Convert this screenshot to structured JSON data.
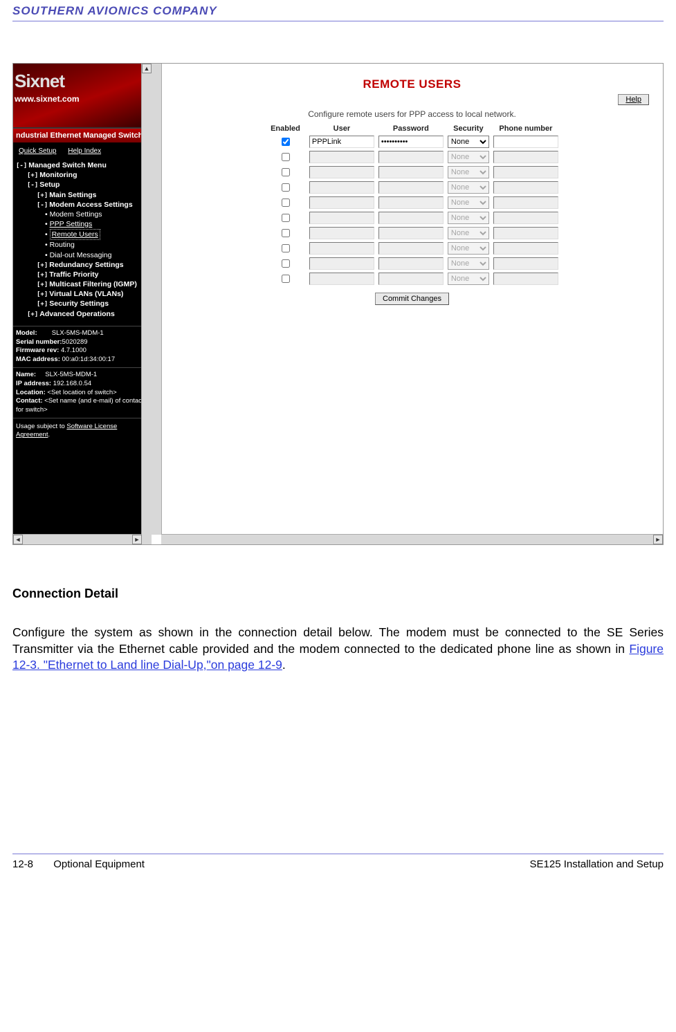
{
  "doc": {
    "header": "SOUTHERN AVIONICS COMPANY",
    "section_heading": "Connection Detail",
    "body_pre": "Configure the system as shown in the connection detail below.  The modem must be connected to the SE Series Transmitter via the Ethernet cable provided and the modem connected to the dedicated phone line as shown in ",
    "body_link": "Figure 12-3. \"Ethernet to Land line Dial-Up,\"on page 12-9",
    "body_post": ".",
    "footer_left_page": "12-8",
    "footer_left_label": "Optional Equipment",
    "footer_right": "SE125 Installation and Setup"
  },
  "app": {
    "logo_name": "Sixnet",
    "logo_url": "www.sixnet.com",
    "switch_title": "ndustrial Ethernet Managed Switch",
    "quick_setup": "Quick Setup",
    "help_index": "Help Index",
    "tree": {
      "root": "Managed Switch Menu",
      "monitoring": "Monitoring",
      "setup": "Setup",
      "main_settings": "Main Settings",
      "modem_access": "Modem Access Settings",
      "modem_settings": "Modem Settings",
      "ppp_settings": "PPP Settings",
      "remote_users": "Remote Users",
      "routing": "Routing",
      "dialout": "Dial-out Messaging",
      "redundancy": "Redundancy Settings",
      "traffic": "Traffic Priority",
      "multicast": "Multicast Filtering (IGMP)",
      "vlans": "Virtual LANs (VLANs)",
      "security": "Security Settings",
      "advanced": "Advanced Operations"
    },
    "device": {
      "model_l": "Model:",
      "model_v": "SLX-5MS-MDM-1",
      "serial_l": "Serial number:",
      "serial_v": "5020289",
      "fw_l": "Firmware rev:",
      "fw_v": "4.7.1000",
      "mac_l": "MAC address:",
      "mac_v": "00:a0:1d:34:00:17",
      "name_l": "Name:",
      "name_v": "SLX-5MS-MDM-1",
      "ip_l": "IP address:",
      "ip_v": "192.168.0.54",
      "loc_l": "Location:",
      "loc_v": "<Set location of switch>",
      "contact_l": "Contact:",
      "contact_v": "<Set name (and e-mail) of contact for switch>"
    },
    "license_pre": "Usage subject to ",
    "license_link": "Software License Agreement",
    "page_title": "REMOTE USERS",
    "help_label": "Help",
    "subtitle": "Configure remote users for PPP access to local network.",
    "cols": {
      "enabled": "Enabled",
      "user": "User",
      "password": "Password",
      "security": "Security",
      "phone": "Phone number"
    },
    "rows": [
      {
        "enabled": true,
        "user": "PPPLink",
        "password": "••••••••••",
        "security": "None",
        "phone": ""
      },
      {
        "enabled": false,
        "user": "",
        "password": "",
        "security": "None",
        "phone": ""
      },
      {
        "enabled": false,
        "user": "",
        "password": "",
        "security": "None",
        "phone": ""
      },
      {
        "enabled": false,
        "user": "",
        "password": "",
        "security": "None",
        "phone": ""
      },
      {
        "enabled": false,
        "user": "",
        "password": "",
        "security": "None",
        "phone": ""
      },
      {
        "enabled": false,
        "user": "",
        "password": "",
        "security": "None",
        "phone": ""
      },
      {
        "enabled": false,
        "user": "",
        "password": "",
        "security": "None",
        "phone": ""
      },
      {
        "enabled": false,
        "user": "",
        "password": "",
        "security": "None",
        "phone": ""
      },
      {
        "enabled": false,
        "user": "",
        "password": "",
        "security": "None",
        "phone": ""
      },
      {
        "enabled": false,
        "user": "",
        "password": "",
        "security": "None",
        "phone": ""
      }
    ],
    "commit_label": "Commit Changes"
  }
}
